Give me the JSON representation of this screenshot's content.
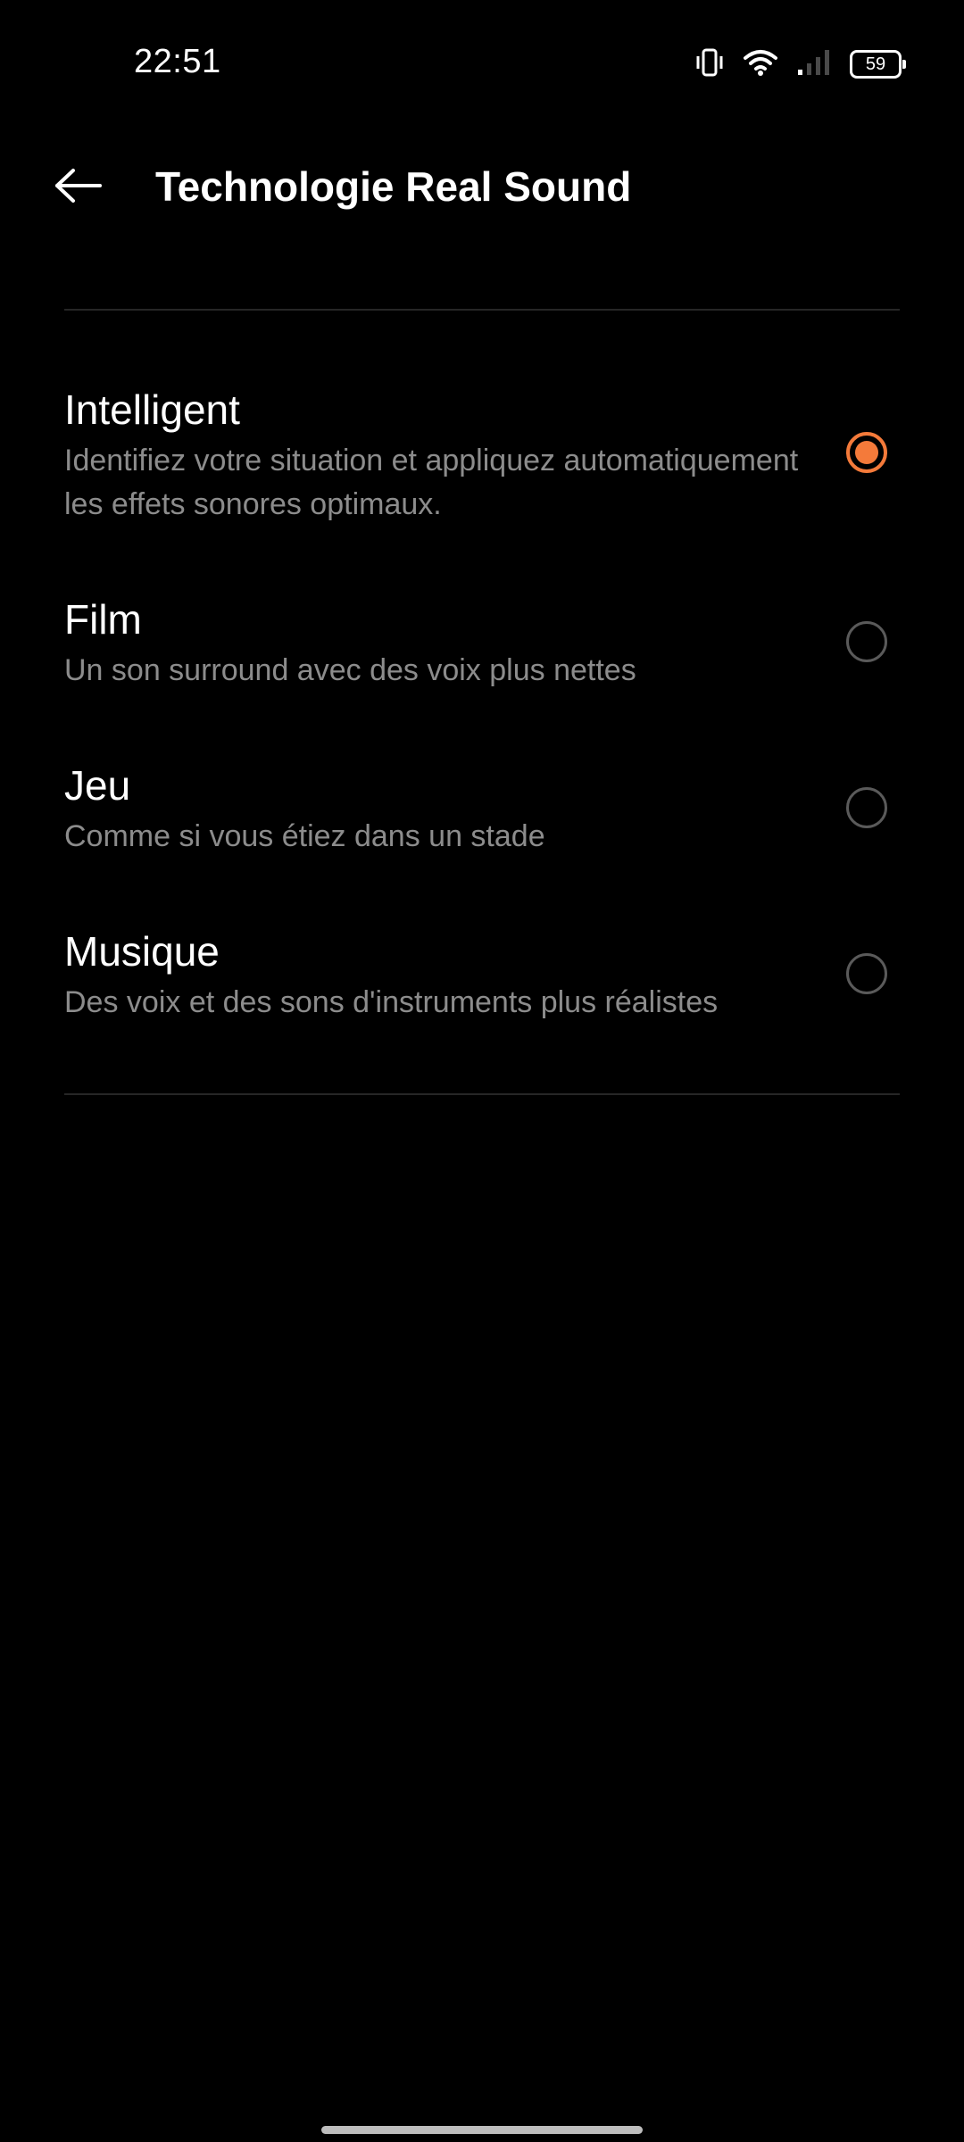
{
  "status_bar": {
    "time": "22:51",
    "battery_level": "59",
    "icons": [
      "vibrate-icon",
      "wifi-icon",
      "signal-icon",
      "battery-icon"
    ]
  },
  "header": {
    "title": "Technologie Real Sound",
    "back_icon": "arrow-left-icon"
  },
  "options": [
    {
      "title": "Intelligent",
      "description": "Identifiez votre situation et appliquez automatiquement les effets sonores optimaux.",
      "selected": true
    },
    {
      "title": "Film",
      "description": "Un son surround avec des voix plus nettes",
      "selected": false
    },
    {
      "title": "Jeu",
      "description": "Comme si vous étiez dans un stade",
      "selected": false
    },
    {
      "title": "Musique",
      "description": "Des voix et des sons d'instruments plus réalistes",
      "selected": false
    }
  ],
  "colors": {
    "background": "#000000",
    "accent": "#f47a3a",
    "primary_text": "#ffffff",
    "secondary_text": "#8c8c8c",
    "divider": "#262626"
  }
}
